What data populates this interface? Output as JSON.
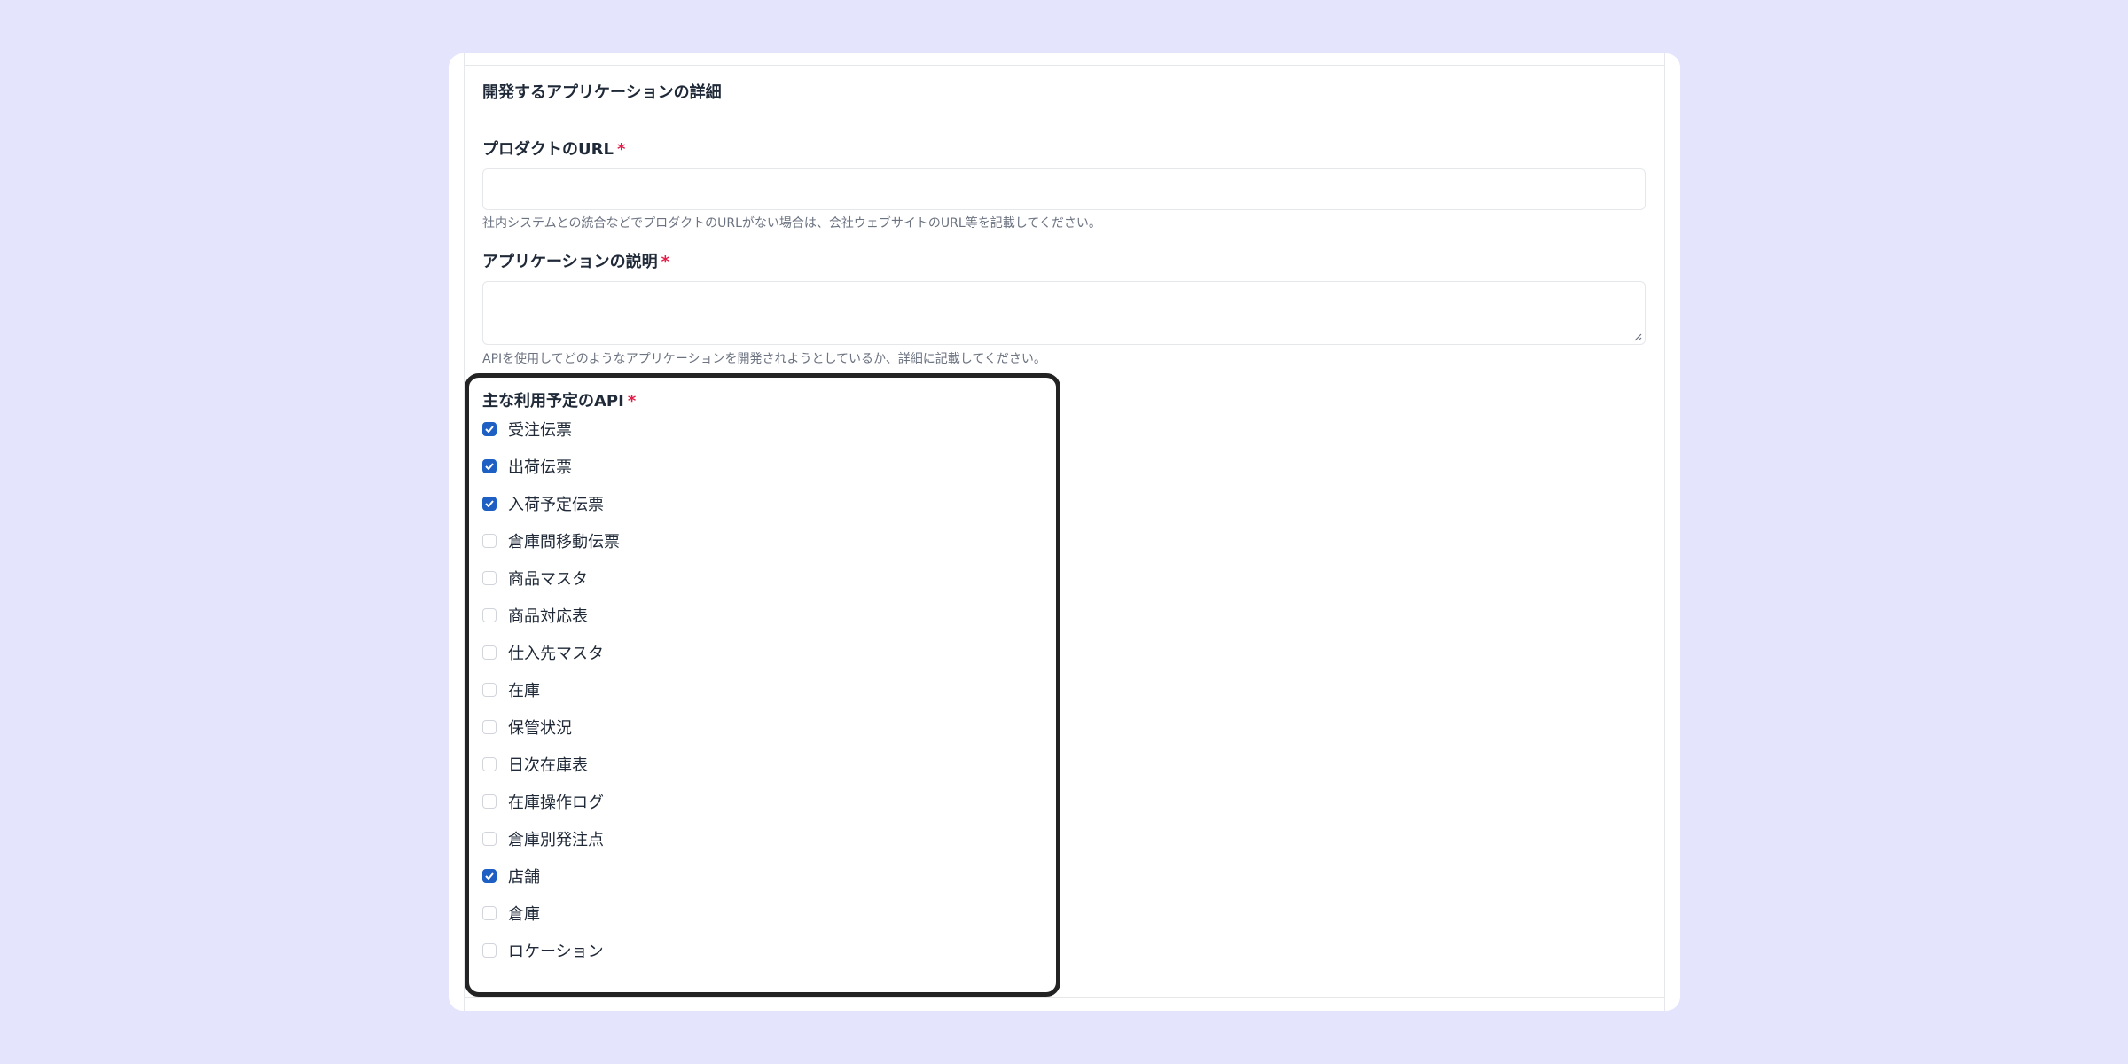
{
  "form": {
    "section_title": "開発するアプリケーションの詳細",
    "required_mark": "*",
    "product_url": {
      "label": "プロダクトのURL",
      "value": "",
      "help": "社内システムとの統合などでプロダクトのURLがない場合は、会社ウェブサイトのURL等を記載してください。"
    },
    "app_description": {
      "label": "アプリケーションの説明",
      "value": "",
      "help": "APIを使用してどのようなアプリケーションを開発されようとしているか、詳細に記載してください。"
    },
    "apis": {
      "label": "主な利用予定のAPI",
      "items": [
        {
          "label": "受注伝票",
          "checked": true
        },
        {
          "label": "出荷伝票",
          "checked": true
        },
        {
          "label": "入荷予定伝票",
          "checked": true
        },
        {
          "label": "倉庫間移動伝票",
          "checked": false
        },
        {
          "label": "商品マスタ",
          "checked": false
        },
        {
          "label": "商品対応表",
          "checked": false
        },
        {
          "label": "仕入先マスタ",
          "checked": false
        },
        {
          "label": "在庫",
          "checked": false
        },
        {
          "label": "保管状況",
          "checked": false
        },
        {
          "label": "日次在庫表",
          "checked": false
        },
        {
          "label": "在庫操作ログ",
          "checked": false
        },
        {
          "label": "倉庫別発注点",
          "checked": false
        },
        {
          "label": "店舗",
          "checked": true
        },
        {
          "label": "倉庫",
          "checked": false
        },
        {
          "label": "ロケーション",
          "checked": false
        }
      ]
    }
  },
  "colors": {
    "page_background": "#e4e4fd",
    "checkbox_checked": "#1e5fc4",
    "required": "#e11d48",
    "highlight_border": "#232323"
  }
}
